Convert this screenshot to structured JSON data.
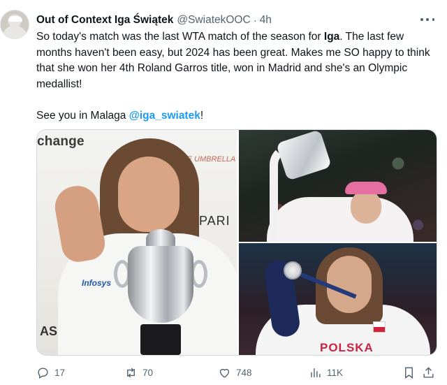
{
  "tweet": {
    "author_name": "Out of Context Iga Świątek",
    "handle": "@SwiatekOOC",
    "separator": "·",
    "time": "4h",
    "text_line_1_a": "So today's match was the last WTA match of the season for ",
    "text_line_1_bold": "Iga",
    "text_line_1_b": ". The last few months haven't been easy, but 2024 has been great. Makes me SO happy to think that she won her 4th Roland Garros title, won in Madrid and she's an Olympic medallist!",
    "text_line_2_a": "See you in Malaga ",
    "mention": "@iga_swiatek",
    "text_line_2_b": "!"
  },
  "media": {
    "left_banner": "change",
    "left_banner2": "THE UMBRELLA SE",
    "left_paris": "PARI",
    "left_logo": "Infosys",
    "left_corner": "AS",
    "bottom_right_text": "POLSKA"
  },
  "actions": {
    "replies": "17",
    "reposts": "70",
    "likes": "748",
    "views": "11K"
  },
  "icons": {
    "reply": "reply-icon",
    "repost": "repost-icon",
    "like": "heart-icon",
    "views": "views-icon",
    "bookmark": "bookmark-icon",
    "share": "share-icon",
    "more": "more-icon"
  },
  "colors": {
    "link": "#1d9bf0",
    "secondary_text": "#536471",
    "primary_text": "#0f1419"
  }
}
